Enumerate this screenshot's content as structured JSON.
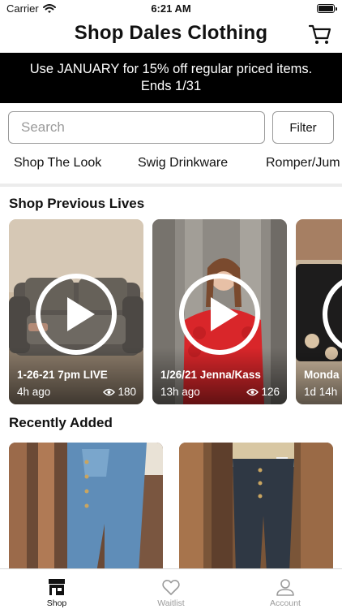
{
  "status_bar": {
    "carrier": "Carrier",
    "time": "6:21 AM"
  },
  "header": {
    "title": "Shop Dales Clothing",
    "cart_icon": "shopping-cart-icon"
  },
  "promo": {
    "line1": "Use JANUARY for 15% off regular priced items.",
    "line2": "Ends 1/31"
  },
  "search": {
    "placeholder": "Search",
    "value": "",
    "filter_label": "Filter"
  },
  "categories": [
    "Shop The Look",
    "Swig Drinkware",
    "Romper/Jum"
  ],
  "sections": {
    "previous_lives": "Shop Previous Lives",
    "recently_added": "Recently Added"
  },
  "lives": [
    {
      "title": "1-26-21 7pm LIVE",
      "time": "4h ago",
      "views": "180"
    },
    {
      "title": "1/26/21 Jenna/Kass",
      "time": "13h ago",
      "views": "126"
    },
    {
      "title": "Monda",
      "time": "1d 14h",
      "views": ""
    }
  ],
  "tabs": [
    {
      "label": "Shop",
      "icon": "storefront-icon",
      "active": true
    },
    {
      "label": "Waitlist",
      "icon": "heart-icon",
      "active": false
    },
    {
      "label": "Account",
      "icon": "person-icon",
      "active": false
    }
  ],
  "colors": {
    "banner_bg": "#000000",
    "active_tab": "#111111",
    "inactive_tab": "#9b9b9b",
    "divider": "#ececec"
  }
}
